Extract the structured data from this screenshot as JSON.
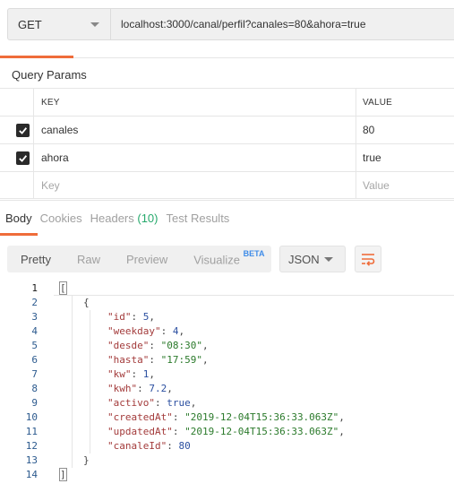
{
  "request": {
    "method": "GET",
    "url": "localhost:3000/canal/perfil?canales=80&ahora=true"
  },
  "query_params": {
    "title": "Query Params",
    "col_key": "KEY",
    "col_value": "VALUE",
    "rows": [
      {
        "key": "canales",
        "value": "80",
        "checked": true
      },
      {
        "key": "ahora",
        "value": "true",
        "checked": true
      }
    ],
    "placeholder_key": "Key",
    "placeholder_value": "Value"
  },
  "response_tabs": {
    "body": "Body",
    "cookies": "Cookies",
    "headers": "Headers",
    "headers_count": "(10)",
    "test_results": "Test Results"
  },
  "view": {
    "pretty": "Pretty",
    "raw": "Raw",
    "preview": "Preview",
    "visualize": "Visualize",
    "visualize_badge": "BETA",
    "format": "JSON",
    "wrap_icon": "wrap-lines-icon"
  },
  "body_lines": [
    {
      "n": "1",
      "text": "["
    },
    {
      "n": "2",
      "text": "{"
    },
    {
      "n": "3",
      "key": "\"id\"",
      "val": "5",
      "type": "n"
    },
    {
      "n": "4",
      "key": "\"weekday\"",
      "val": "4",
      "type": "n"
    },
    {
      "n": "5",
      "key": "\"desde\"",
      "val": "\"08:30\"",
      "type": "s"
    },
    {
      "n": "6",
      "key": "\"hasta\"",
      "val": "\"17:59\"",
      "type": "s"
    },
    {
      "n": "7",
      "key": "\"kw\"",
      "val": "1",
      "type": "n"
    },
    {
      "n": "8",
      "key": "\"kwh\"",
      "val": "7.2",
      "type": "n"
    },
    {
      "n": "9",
      "key": "\"activo\"",
      "val": "true",
      "type": "b"
    },
    {
      "n": "10",
      "key": "\"createdAt\"",
      "val": "\"2019-12-04T15:36:33.063Z\"",
      "type": "s"
    },
    {
      "n": "11",
      "key": "\"updatedAt\"",
      "val": "\"2019-12-04T15:36:33.063Z\"",
      "type": "s"
    },
    {
      "n": "12",
      "key": "\"canaleId\"",
      "val": "80",
      "type": "n"
    },
    {
      "n": "13",
      "text": "}"
    },
    {
      "n": "14",
      "text": "]"
    }
  ],
  "colors": {
    "accent": "#ef6c3a",
    "count_green": "#26a96c",
    "beta_blue": "#3f8ce8"
  }
}
